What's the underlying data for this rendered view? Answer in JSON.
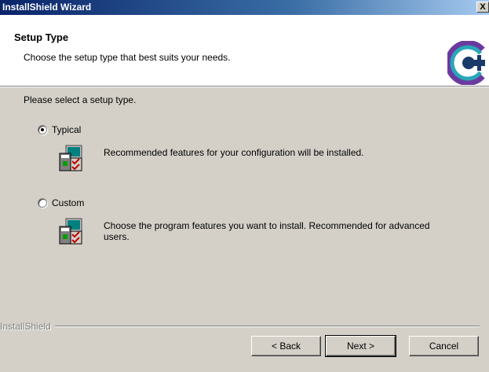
{
  "window": {
    "title": "InstallShield Wizard",
    "close_label": "X"
  },
  "header": {
    "title": "Setup Type",
    "subtitle": "Choose the setup type that best suits your needs.",
    "logo_icon": "installshield-logo-icon"
  },
  "body": {
    "prompt": "Please select a setup type.",
    "options": [
      {
        "label": "Typical",
        "selected": true,
        "icon": "typical-setup-icon",
        "description": "Recommended features for your configuration will be installed."
      },
      {
        "label": "Custom",
        "selected": false,
        "icon": "custom-setup-icon",
        "description": "Choose the program features you want to install.  Recommended for advanced users."
      }
    ]
  },
  "footer": {
    "brand": "InstallShield",
    "back_label": "< Back",
    "next_label": "Next >",
    "cancel_label": "Cancel"
  },
  "colors": {
    "titlebar_start": "#0a246a",
    "titlebar_end": "#a6caf0",
    "face": "#d4d0c8",
    "logo_teal": "#2aa6b8",
    "logo_purple": "#6b3aa0"
  }
}
